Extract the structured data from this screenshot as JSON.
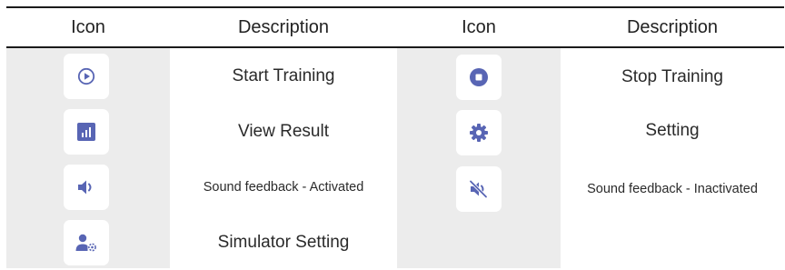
{
  "header": {
    "col1": "Icon",
    "col2": "Description",
    "col3": "Icon",
    "col4": "Description"
  },
  "left_rows": [
    {
      "icon": "play-circle-icon",
      "label": "Start Training"
    },
    {
      "icon": "bar-chart-icon",
      "label": "View Result"
    },
    {
      "icon": "volume-up-icon",
      "label": "Sound feedback - Activated"
    },
    {
      "icon": "user-settings-icon",
      "label": "Simulator Setting"
    }
  ],
  "right_rows": [
    {
      "icon": "stop-circle-icon",
      "label": "Stop Training"
    },
    {
      "icon": "gear-icon",
      "label": "Setting"
    },
    {
      "icon": "volume-mute-icon",
      "label": "Sound feedback - Inactivated"
    }
  ],
  "colors": {
    "icon_accent": "#5865b4",
    "column_bg": "#ececec",
    "rule": "#1b1b1b"
  }
}
